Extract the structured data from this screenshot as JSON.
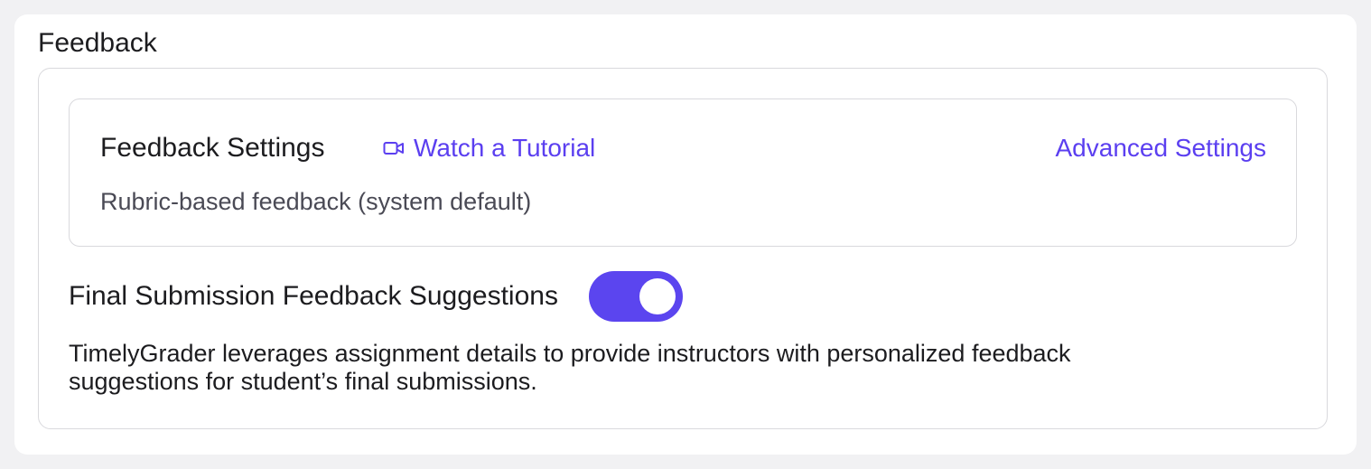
{
  "section": {
    "title": "Feedback"
  },
  "feedback_settings": {
    "title": "Feedback Settings",
    "tutorial_link": {
      "label": "Watch a Tutorial",
      "icon": "video-camera-icon"
    },
    "advanced_link": "Advanced Settings",
    "subtitle": "Rubric-based feedback (system default)"
  },
  "final_submission": {
    "label": "Final Submission Feedback Suggestions",
    "toggle_on": true,
    "description": "TimelyGrader leverages assignment details to provide instructors with personalized feedback suggestions for student’s final submissions."
  },
  "colors": {
    "accent": "#5b45ef",
    "link": "#5b3ff0",
    "border": "#d9d9dd",
    "muted_text": "#4a4a55"
  }
}
